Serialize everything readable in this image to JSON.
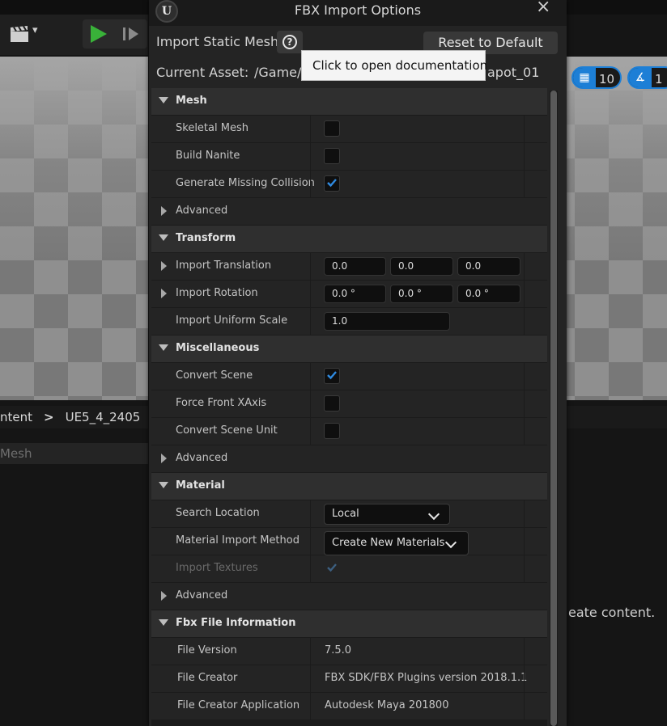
{
  "background": {
    "viewport_chip_grid": "10",
    "viewport_chip_angle": "1",
    "breadcrumb_partial": "ntent",
    "breadcrumb_sep": ">",
    "breadcrumb_folder": "UE5_4_2405",
    "search_partial": "Mesh",
    "right_hint": "eate content."
  },
  "dialog": {
    "title": "FBX Import Options",
    "close_glyph": "×",
    "logo_glyph": "U",
    "header_title": "Import Static Mesh",
    "help_glyph": "?",
    "reset_label": "Reset to Default",
    "asset_label": "Current Asset:",
    "asset_path_start": "/Game/",
    "asset_path_end": "apot_01",
    "tooltip": "Click to open documentation"
  },
  "sections": {
    "mesh": {
      "label": "Mesh",
      "skeletal_mesh": "Skeletal Mesh",
      "build_nanite": "Build Nanite",
      "generate_collision": "Generate Missing Collision",
      "advanced": "Advanced"
    },
    "transform": {
      "label": "Transform",
      "import_translation": "Import Translation",
      "translation": [
        "0.0",
        "0.0",
        "0.0"
      ],
      "import_rotation": "Import Rotation",
      "rotation": [
        "0.0 °",
        "0.0 °",
        "0.0 °"
      ],
      "import_uniform_scale": "Import Uniform Scale",
      "scale": "1.0"
    },
    "misc": {
      "label": "Miscellaneous",
      "convert_scene": "Convert Scene",
      "force_front_xaxis": "Force Front XAxis",
      "convert_scene_unit": "Convert Scene Unit",
      "advanced": "Advanced"
    },
    "material": {
      "label": "Material",
      "search_location": "Search Location",
      "search_location_value": "Local",
      "material_import_method": "Material Import Method",
      "material_import_method_value": "Create New Materials",
      "import_textures": "Import Textures",
      "advanced": "Advanced"
    },
    "fbx_info": {
      "label": "Fbx File Information",
      "file_version": "File Version",
      "file_version_value": "7.5.0",
      "file_creator": "File Creator",
      "file_creator_value": "FBX SDK/FBX Plugins version 2018.1.1",
      "file_creator_app": "File Creator Application",
      "file_creator_app_value": "Autodesk Maya 201800"
    }
  },
  "checkbox_states": {
    "skeletal_mesh": false,
    "build_nanite": false,
    "generate_missing_collision": true,
    "convert_scene": true,
    "force_front_xaxis": false,
    "convert_scene_unit": false,
    "import_textures": true
  },
  "colors": {
    "accent": "#1d7fd6",
    "play": "#39b239",
    "tooltip_bg": "#f4f4f4"
  }
}
